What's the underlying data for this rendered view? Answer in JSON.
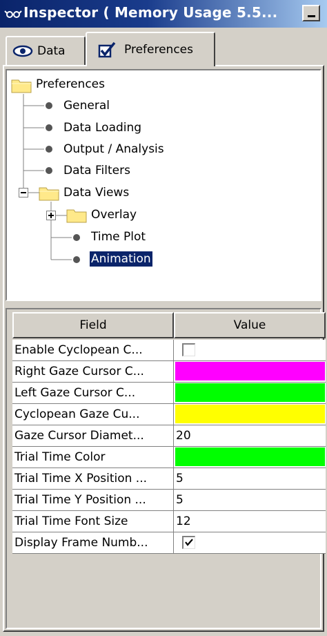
{
  "window": {
    "title": "Inspector ( Memory Usage 5.5...",
    "title_icon": "glasses-icon",
    "minimize_icon": "minimize-icon"
  },
  "tabs": [
    {
      "label": "Data",
      "icon": "eye-icon",
      "selected": false
    },
    {
      "label": "Preferences",
      "icon": "checkbox-icon",
      "selected": true
    }
  ],
  "tree": {
    "root": "Preferences",
    "items": [
      {
        "label": "General",
        "type": "leaf"
      },
      {
        "label": "Data Loading",
        "type": "leaf"
      },
      {
        "label": "Output / Analysis",
        "type": "leaf"
      },
      {
        "label": "Data Filters",
        "type": "leaf"
      },
      {
        "label": "Data Views",
        "type": "folder",
        "expanded": true
      },
      {
        "label": "Overlay",
        "type": "folder",
        "expanded": false
      },
      {
        "label": "Time Plot",
        "type": "leaf"
      },
      {
        "label": "Animation",
        "type": "leaf",
        "selected": true
      }
    ]
  },
  "table": {
    "headers": {
      "field": "Field",
      "value": "Value"
    },
    "rows": [
      {
        "field": "Enable Cyclopean C...",
        "kind": "checkbox",
        "checked": false
      },
      {
        "field": "Right Gaze Cursor C...",
        "kind": "color",
        "color": "#ff00ff"
      },
      {
        "field": "Left Gaze Cursor C...",
        "kind": "color",
        "color": "#00ff00"
      },
      {
        "field": "Cyclopean Gaze Cu...",
        "kind": "color",
        "color": "#ffff00"
      },
      {
        "field": "Gaze Cursor Diamet...",
        "kind": "text",
        "value": "20"
      },
      {
        "field": "Trial Time Color",
        "kind": "color",
        "color": "#00ff00"
      },
      {
        "field": "Trial Time X Position ...",
        "kind": "text",
        "value": "5"
      },
      {
        "field": "Trial Time Y Position ...",
        "kind": "text",
        "value": "5"
      },
      {
        "field": "Trial Time Font Size",
        "kind": "text",
        "value": "12"
      },
      {
        "field": "Display Frame Numb...",
        "kind": "checkbox",
        "checked": true
      }
    ]
  },
  "colors": {
    "titlebar": "#0a246a",
    "selection": "#0a246a",
    "face": "#d4d0c8"
  }
}
